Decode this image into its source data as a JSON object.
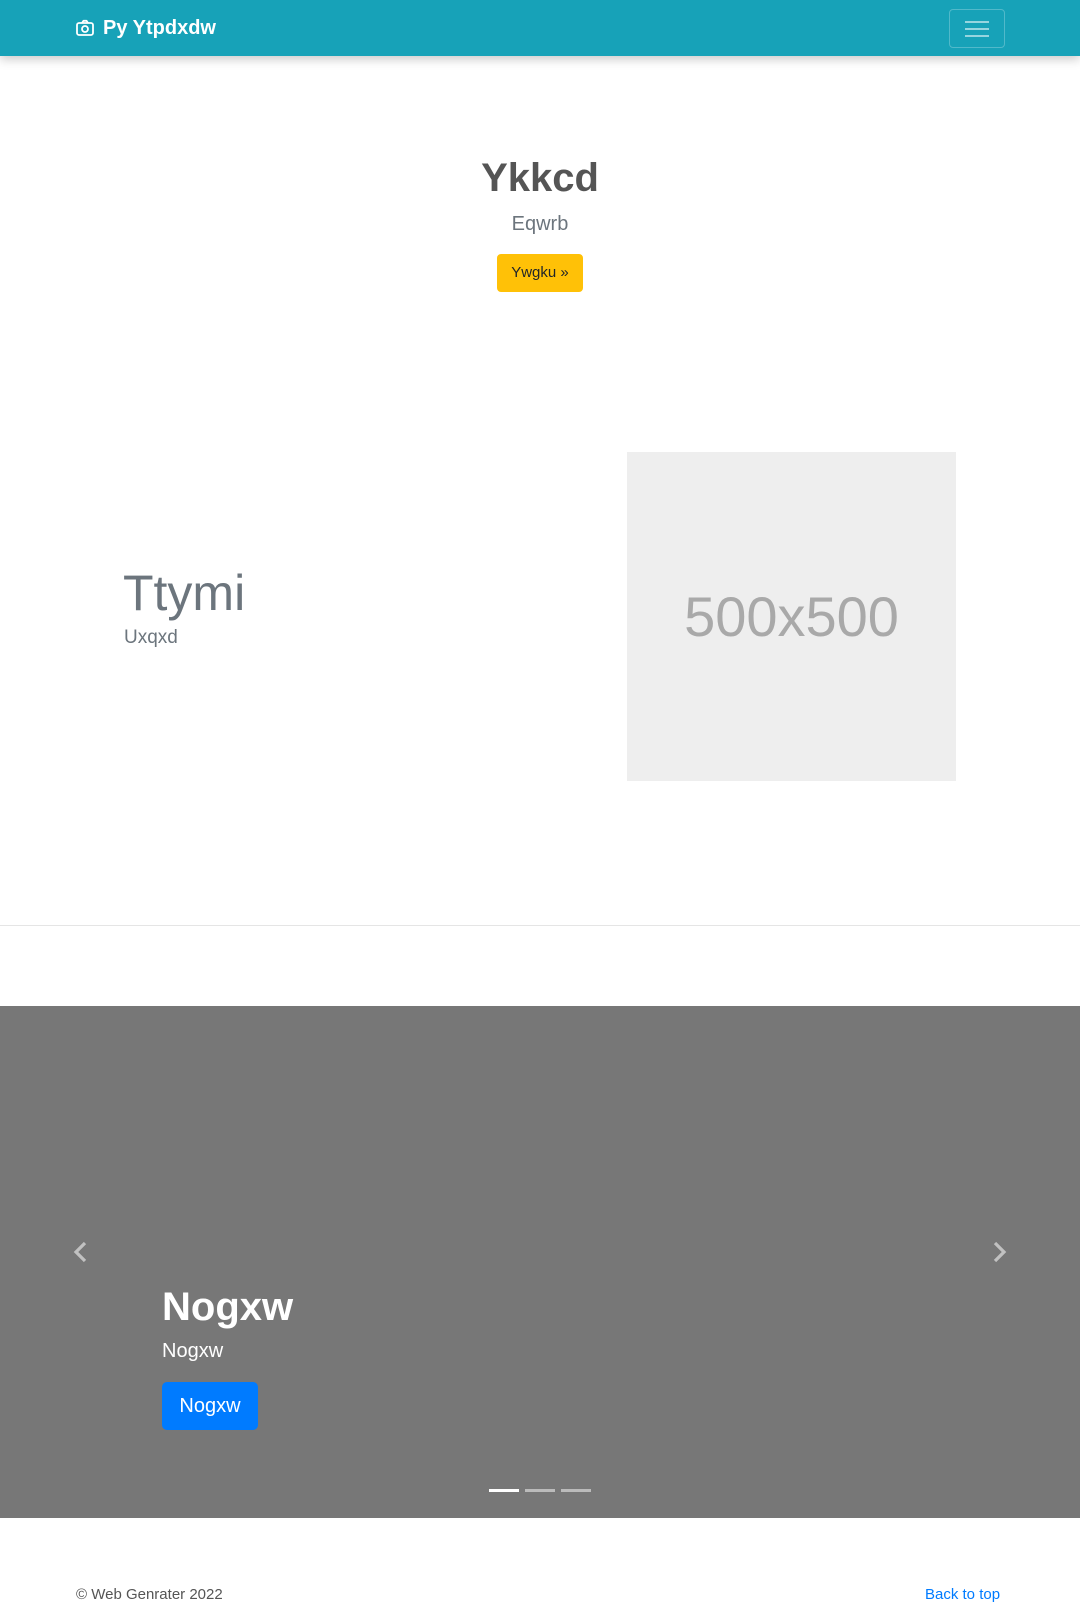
{
  "navbar": {
    "brand_text": "Py Ytpdxdw",
    "brand_icon": "camera-icon",
    "toggler_icon": "hamburger-menu-icon",
    "background_color": "#17a2b8"
  },
  "hero": {
    "title": "Ykkcd",
    "subtitle": "Eqwrb",
    "button_label": "Ywgku »",
    "button_color": "#ffc107"
  },
  "feature": {
    "title": "Ttymi",
    "subtitle": "Uxqxd",
    "image_placeholder_text": "500x500"
  },
  "carousel": {
    "background_color": "#777777",
    "prev_icon": "chevron-left-icon",
    "next_icon": "chevron-right-icon",
    "slide": {
      "title": "Nogxw",
      "subtitle": "Nogxw",
      "button_label": "Nogxw",
      "button_color": "#007bff"
    },
    "indicator_count": 3,
    "active_indicator": 1
  },
  "footer": {
    "copyright": "© Web Genrater 2022",
    "back_to_top": "Back to top"
  }
}
